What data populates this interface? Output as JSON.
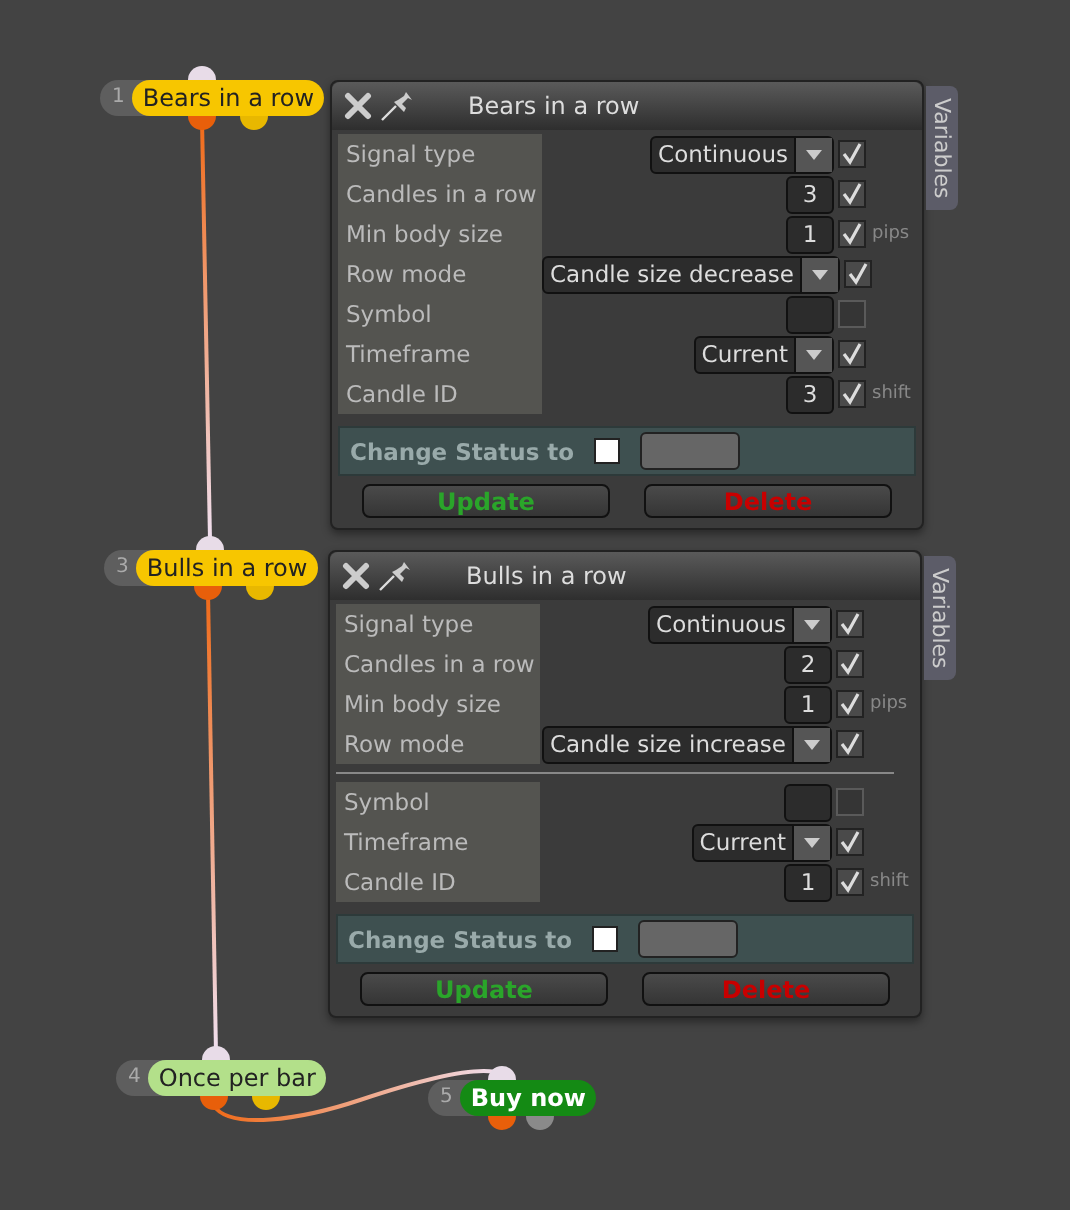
{
  "nodes": [
    {
      "number": "1",
      "label": "Bears in a row",
      "color": "#f7c600"
    },
    {
      "number": "3",
      "label": "Bulls in a row",
      "color": "#f7c600"
    },
    {
      "number": "4",
      "label": "Once per bar",
      "color": "#b3e08a"
    },
    {
      "number": "5",
      "label": "Buy now",
      "color": "#148a14"
    }
  ],
  "panels": [
    {
      "title": "Bears in a row",
      "tab": "Variables",
      "groups": [
        [
          {
            "kind": "select",
            "label": "Signal type",
            "value": "Continuous",
            "checked": true
          },
          {
            "kind": "number",
            "label": "Candles in a row",
            "value": "3",
            "checked": true
          },
          {
            "kind": "number",
            "label": "Min body size",
            "value": "1",
            "checked": true,
            "unit": "pips"
          },
          {
            "kind": "select",
            "label": "Row mode",
            "value": "Candle size decrease",
            "checked": true
          },
          {
            "kind": "empty",
            "label": "Symbol",
            "checked": false
          },
          {
            "kind": "select",
            "label": "Timeframe",
            "value": "Current",
            "checked": true
          },
          {
            "kind": "number",
            "label": "Candle ID",
            "value": "3",
            "checked": true,
            "unit": "shift"
          }
        ]
      ],
      "status": {
        "label": "Change Status to",
        "checked": false
      },
      "buttons": [
        {
          "label": "Update",
          "color": "#2aa52a"
        },
        {
          "label": "Delete",
          "color": "#c80000"
        }
      ]
    },
    {
      "title": "Bulls in a row",
      "tab": "Variables",
      "groups": [
        [
          {
            "kind": "select",
            "label": "Signal type",
            "value": "Continuous",
            "checked": true
          },
          {
            "kind": "number",
            "label": "Candles in a row",
            "value": "2",
            "checked": true
          },
          {
            "kind": "number",
            "label": "Min body size",
            "value": "1",
            "checked": true,
            "unit": "pips"
          },
          {
            "kind": "select",
            "label": "Row mode",
            "value": "Candle size increase",
            "checked": true
          }
        ],
        [
          {
            "kind": "empty",
            "label": "Symbol",
            "checked": false
          },
          {
            "kind": "select",
            "label": "Timeframe",
            "value": "Current",
            "checked": true
          },
          {
            "kind": "number",
            "label": "Candle ID",
            "value": "1",
            "checked": true,
            "unit": "shift"
          }
        ]
      ],
      "status": {
        "label": "Change Status to",
        "checked": false
      },
      "buttons": [
        {
          "label": "Update",
          "color": "#2aa52a"
        },
        {
          "label": "Delete",
          "color": "#c80000"
        }
      ]
    }
  ]
}
